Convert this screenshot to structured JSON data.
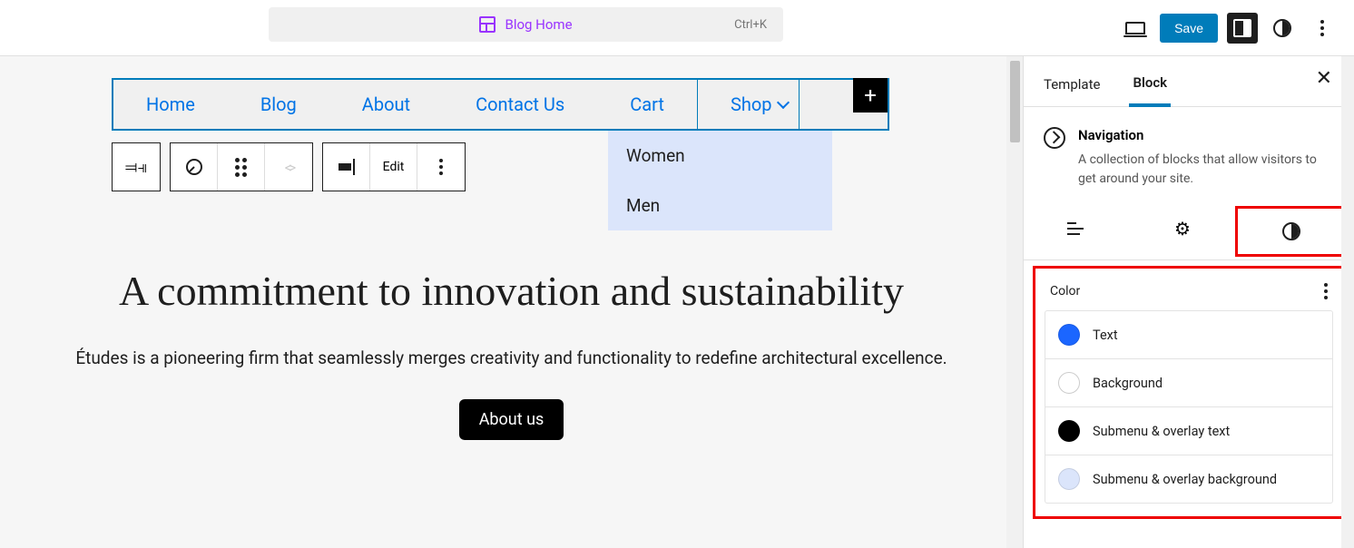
{
  "topbar": {
    "template_label": "Blog Home",
    "shortcut": "Ctrl+K",
    "save_label": "Save"
  },
  "nav": {
    "items": [
      "Home",
      "Blog",
      "About",
      "Contact Us",
      "Cart",
      "Shop"
    ],
    "submenu": [
      "Women",
      "Men"
    ]
  },
  "toolbar": {
    "edit_label": "Edit"
  },
  "hero": {
    "heading": "A commitment to innovation and sustainability",
    "paragraph": "Études is a pioneering firm that seamlessly merges creativity and functionality to redefine architectural excellence.",
    "button": "About us"
  },
  "sidebar": {
    "tabs": {
      "template": "Template",
      "block": "Block"
    },
    "block_name": "Navigation",
    "block_desc": "A collection of blocks that allow visitors to get around your site.",
    "color_title": "Color",
    "colors": [
      {
        "label": "Text",
        "value": "#1b66ff"
      },
      {
        "label": "Background",
        "value": "#ffffff"
      },
      {
        "label": "Submenu & overlay text",
        "value": "#000000"
      },
      {
        "label": "Submenu & overlay background",
        "value": "#dbe5fb"
      }
    ]
  }
}
